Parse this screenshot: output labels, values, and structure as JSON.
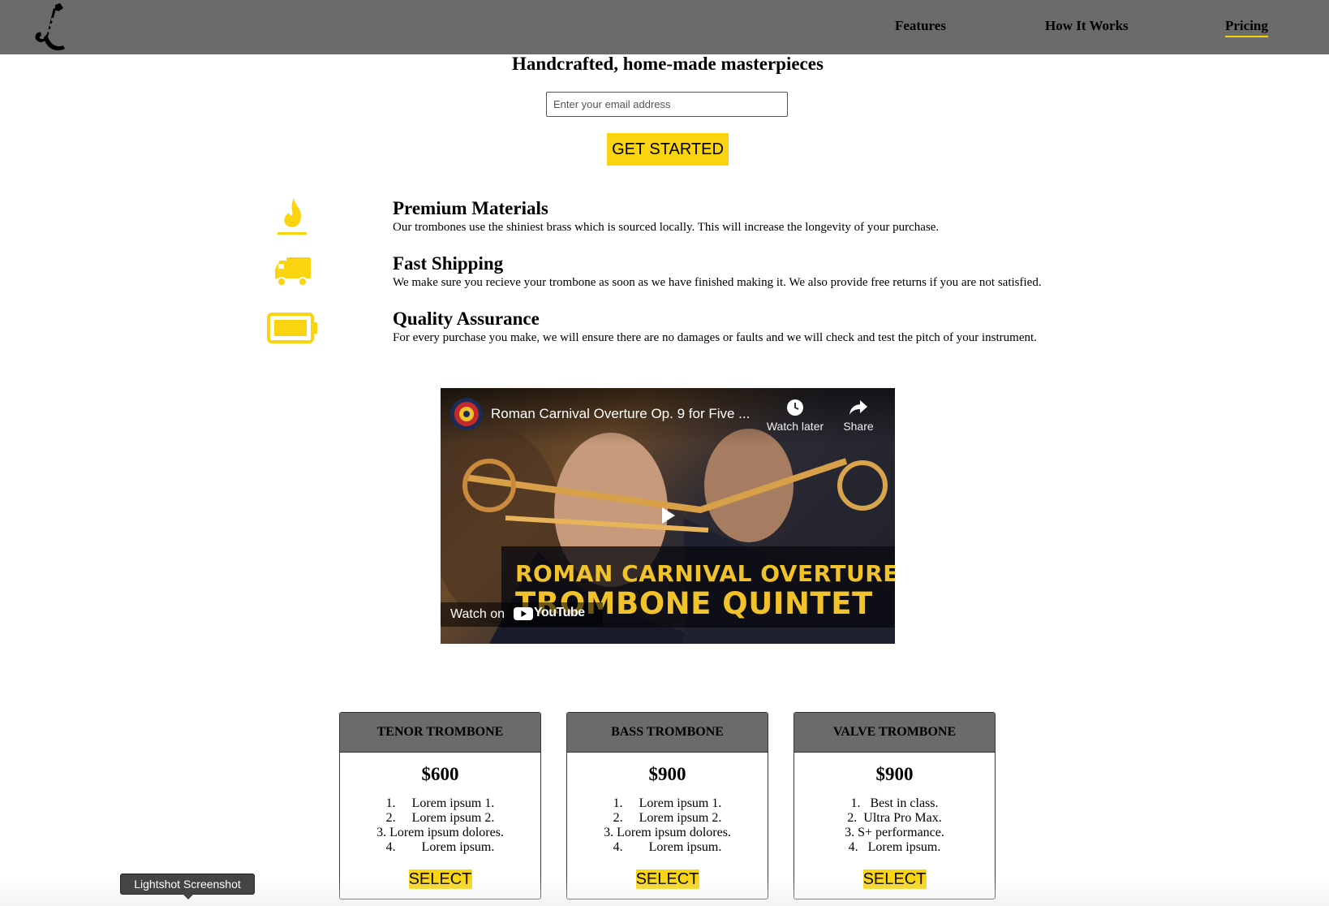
{
  "nav": {
    "links": [
      "Features",
      "How It Works",
      "Pricing"
    ],
    "active": "Pricing",
    "logo_icon": "saxophone-icon"
  },
  "hero": {
    "title": "Handcrafted, home-made masterpieces",
    "email_placeholder": "Enter your email address",
    "cta_label": "GET STARTED"
  },
  "features": [
    {
      "icon": "flame-icon",
      "title": "Premium Materials",
      "text": "Our trombones use the shiniest brass which is sourced locally. This will increase the longevity of your purchase."
    },
    {
      "icon": "truck-icon",
      "title": "Fast Shipping",
      "text": "We make sure you recieve your trombone as soon as we have finished making it. We also provide free returns if you are not satisfied."
    },
    {
      "icon": "battery-full-icon",
      "title": "Quality Assurance",
      "text": "For every purchase you make, we will ensure there are no damages or faults and we will check and test the pitch of your instrument."
    }
  ],
  "video": {
    "title": "Roman Carnival Overture Op. 9 for Five ...",
    "watch_later": "Watch later",
    "share": "Share",
    "banner_line1": "ROMAN CARNIVAL OVERTURE",
    "banner_line2": "TROMBONE QUINTET",
    "watch_on": "Watch on",
    "youtube": "YouTube"
  },
  "pricing": [
    {
      "name": "TENOR TROMBONE",
      "price": "$600",
      "items": [
        "Lorem ipsum 1.",
        "Lorem ipsum 2.",
        "Lorem ipsum dolores.",
        "Lorem ipsum."
      ],
      "button": "SELECT"
    },
    {
      "name": "BASS TROMBONE",
      "price": "$900",
      "items": [
        "Lorem ipsum 1.",
        "Lorem ipsum 2.",
        "Lorem ipsum dolores.",
        "Lorem ipsum."
      ],
      "button": "SELECT"
    },
    {
      "name": "VALVE TROMBONE",
      "price": "$900",
      "items": [
        "Best in class.",
        "Ultra Pro Max.",
        "S+ performance.",
        "Lorem ipsum."
      ],
      "button": "SELECT"
    }
  ],
  "overlay": {
    "tooltip": "Lightshot Screenshot"
  },
  "colors": {
    "accent": "#f9d40f",
    "header_bg": "#6b6b6b"
  }
}
